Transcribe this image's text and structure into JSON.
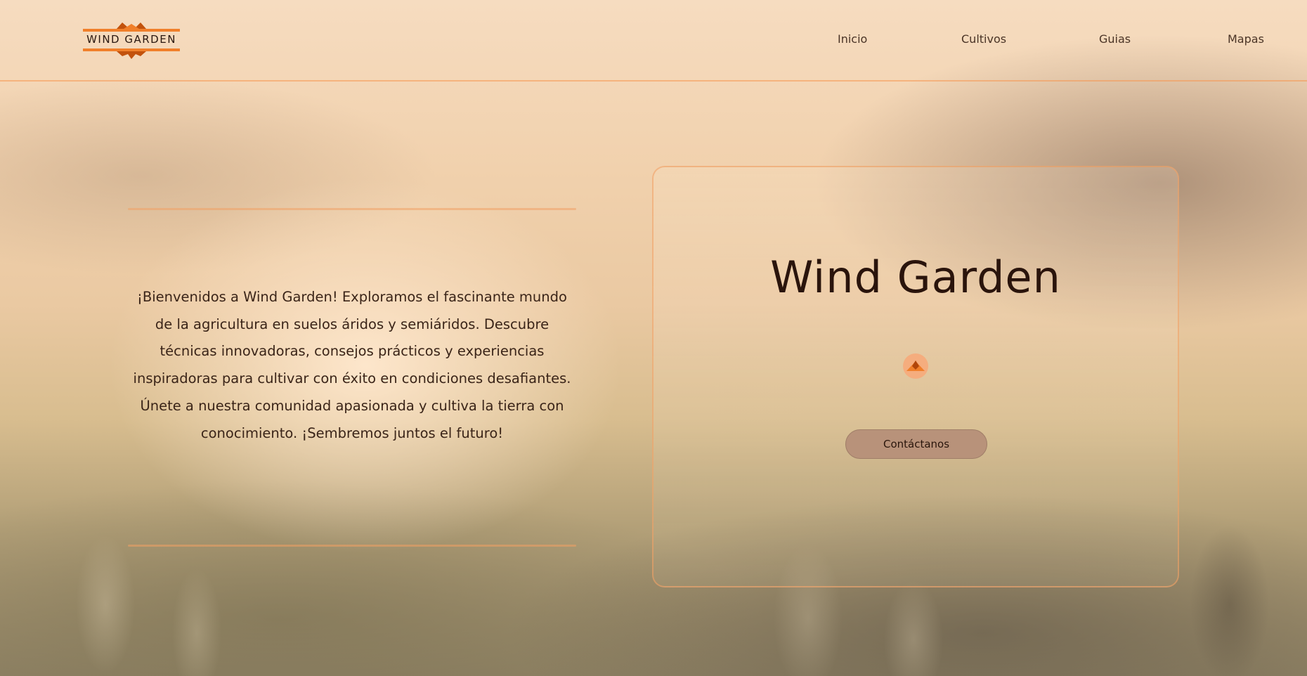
{
  "brand": {
    "logo_text": "WIND GARDEN",
    "accent_color": "#f07f2a"
  },
  "nav": {
    "items": [
      {
        "label": "Inicio"
      },
      {
        "label": "Cultivos"
      },
      {
        "label": "Guias"
      },
      {
        "label": "Mapas"
      }
    ]
  },
  "intro": {
    "text": "¡Bienvenidos a Wind Garden! Exploramos el fascinante mundo de la agricultura en suelos áridos y semiáridos. Descubre técnicas innovadoras, consejos prácticos y experiencias inspiradoras para cultivar con éxito en condiciones desafiantes. Únete a nuestra comunidad apasionada y cultiva la tierra con conocimiento. ¡Sembremos juntos el futuro!"
  },
  "hero_card": {
    "title": "Wind Garden",
    "icon": "mountain-icon",
    "contact_label": "Contáctanos"
  }
}
